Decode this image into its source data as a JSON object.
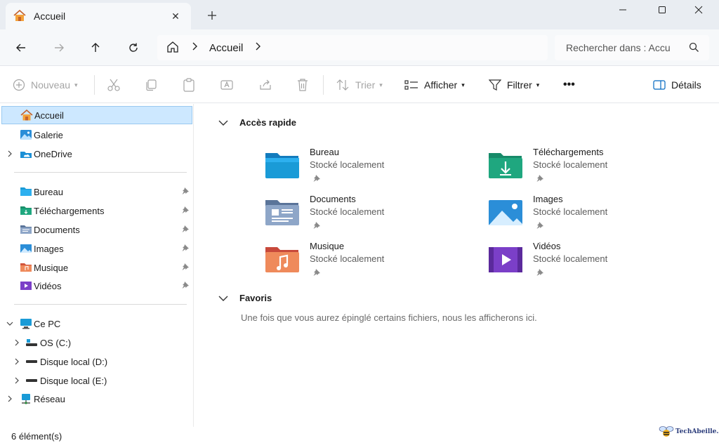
{
  "window": {
    "tab_title": "Accueil",
    "controls": {
      "minimize": "minimize-icon",
      "maximize": "maximize-icon",
      "close": "close-icon"
    }
  },
  "address": {
    "crumb": "Accueil",
    "search_placeholder": "Rechercher dans : Accu"
  },
  "toolbar": {
    "new_label": "Nouveau",
    "sort_label": "Trier",
    "view_label": "Afficher",
    "filter_label": "Filtrer",
    "more_label": "•••",
    "details_label": "Détails"
  },
  "sidebar": {
    "top": [
      {
        "label": "Accueil",
        "icon": "home-icon",
        "selected": true
      },
      {
        "label": "Galerie",
        "icon": "gallery-icon"
      },
      {
        "label": "OneDrive",
        "icon": "onedrive-icon",
        "expandable": true
      }
    ],
    "pinned": [
      {
        "label": "Bureau",
        "icon": "desktop-folder-icon"
      },
      {
        "label": "Téléchargements",
        "icon": "downloads-folder-icon"
      },
      {
        "label": "Documents",
        "icon": "documents-folder-icon"
      },
      {
        "label": "Images",
        "icon": "pictures-folder-icon"
      },
      {
        "label": "Musique",
        "icon": "music-folder-icon"
      },
      {
        "label": "Vidéos",
        "icon": "videos-folder-icon"
      }
    ],
    "computer": {
      "label": "Ce PC",
      "drives": [
        {
          "label": "OS (C:)",
          "icon": "system-drive-icon"
        },
        {
          "label": "Disque local (D:)",
          "icon": "drive-icon"
        },
        {
          "label": "Disque local (E:)",
          "icon": "drive-icon"
        }
      ]
    },
    "network": {
      "label": "Réseau",
      "icon": "network-icon"
    }
  },
  "main": {
    "quick_access": {
      "header": "Accès rapide",
      "items": [
        {
          "name": "Bureau",
          "sub": "Stocké localement",
          "color": "#1a9bd7"
        },
        {
          "name": "Téléchargements",
          "sub": "Stocké localement",
          "color": "#1fa77f"
        },
        {
          "name": "Documents",
          "sub": "Stocké localement",
          "color": "#6d88b0"
        },
        {
          "name": "Images",
          "sub": "Stocké localement",
          "color": "#2b8ed8"
        },
        {
          "name": "Musique",
          "sub": "Stocké localement",
          "color": "#e8734a"
        },
        {
          "name": "Vidéos",
          "sub": "Stocké localement",
          "color": "#8a45d6"
        }
      ]
    },
    "favorites": {
      "header": "Favoris",
      "empty_text": "Une fois que vous aurez épinglé certains fichiers, nous les afficherons ici."
    }
  },
  "status": {
    "count": "6 élément(s)"
  },
  "watermark": {
    "text": "TechAbeille.FR"
  },
  "colors": {
    "accent": "#0067c0",
    "selection": "#cde8ff"
  }
}
